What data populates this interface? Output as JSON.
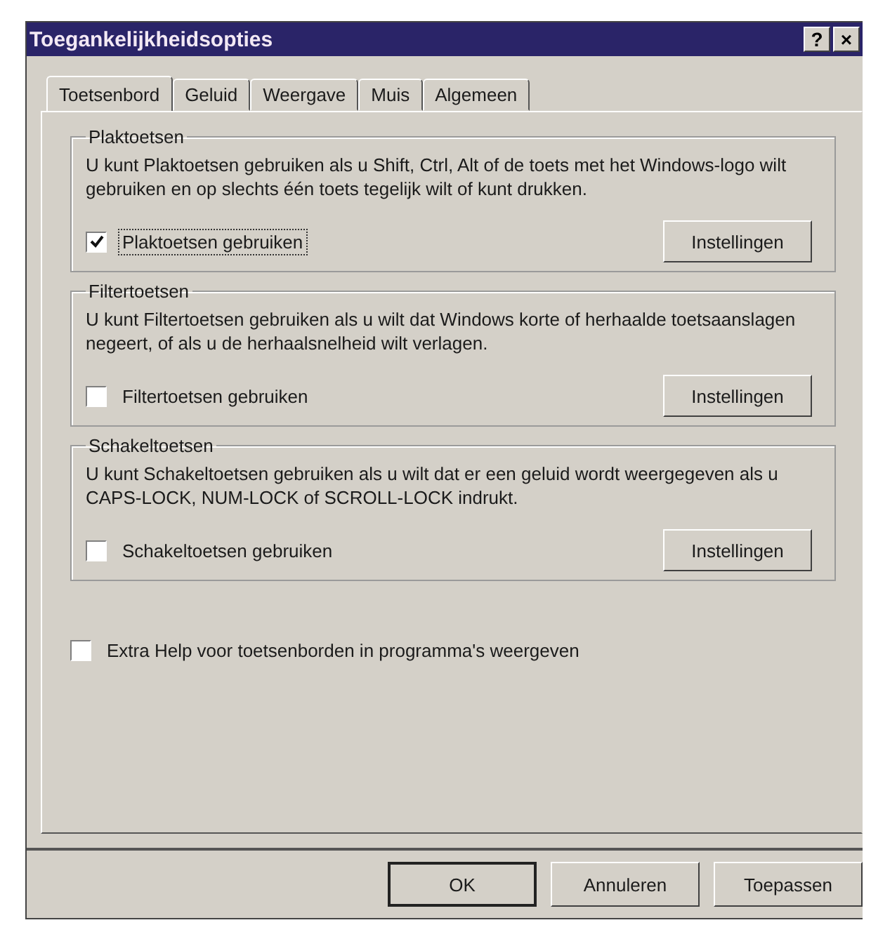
{
  "window": {
    "title": "Toegankelijkheidsopties",
    "title_buttons": [
      "?",
      "×"
    ]
  },
  "tabs": [
    {
      "label": "Toetsenbord",
      "selected": true
    },
    {
      "label": "Geluid",
      "selected": false
    },
    {
      "label": "Weergave",
      "selected": false
    },
    {
      "label": "Muis",
      "selected": false
    },
    {
      "label": "Algemeen",
      "selected": false
    }
  ],
  "groups": [
    {
      "title": "Plaktoetsen",
      "description": "U kunt Plaktoetsen gebruiken als u Shift, Ctrl, Alt of de toets met het Windows-logo wilt gebruiken en op slechts één toets tegelijk wilt of kunt drukken.",
      "checkbox": {
        "label": "Plaktoetsen gebruiken",
        "checked": true,
        "focused": true
      },
      "button": "Instellingen"
    },
    {
      "title": "Filtertoetsen",
      "description": "U kunt Filtertoetsen gebruiken als u wilt dat Windows korte of herhaalde toetsaanslagen negeert, of als u de herhaalsnelheid wilt verlagen.",
      "checkbox": {
        "label": "Filtertoetsen gebruiken",
        "checked": false,
        "focused": false
      },
      "button": "Instellingen"
    },
    {
      "title": "Schakeltoetsen",
      "description": "U kunt Schakeltoetsen gebruiken als u wilt dat er een geluid wordt weergegeven als u CAPS-LOCK, NUM-LOCK of SCROLL-LOCK indrukt.",
      "checkbox": {
        "label": "Schakeltoetsen gebruiken",
        "checked": false,
        "focused": false
      },
      "button": "Instellingen"
    }
  ],
  "extra_checkbox": {
    "label": "Extra Help voor toetsenborden in programma's weergeven",
    "checked": false
  },
  "buttons": [
    {
      "label": "OK",
      "default": true
    },
    {
      "label": "Annuleren",
      "default": false
    },
    {
      "label": "Toepassen",
      "default": false
    }
  ]
}
